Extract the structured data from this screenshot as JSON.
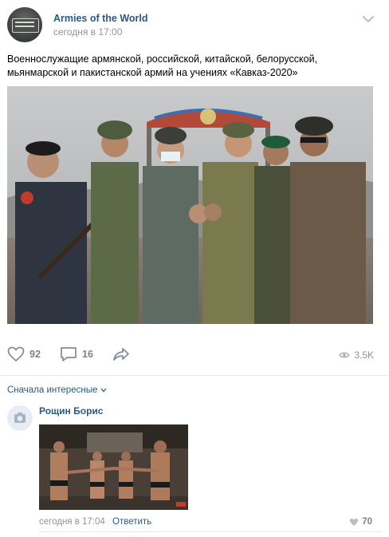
{
  "post": {
    "group_name": "Armies of the World",
    "time": "сегодня в 17:00",
    "text": "Военнослужащие армянской, российской, китайской, белорусской, мьянмарской и пакистанской армий на учениях «Кавказ-2020»",
    "likes": "92",
    "comments": "16",
    "views": "3.5K"
  },
  "icons": {
    "group_avatar": "armies-of-the-world-avatar",
    "menu": "chevron-down-icon",
    "like": "heart-icon",
    "comment": "comment-icon",
    "share": "share-arrow-icon",
    "views": "eye-icon",
    "camera": "camera-icon"
  },
  "comments_section": {
    "sort_label": "Сначала интересные",
    "items": [
      {
        "author": "Рощин Борис",
        "time": "сегодня в 17:04",
        "reply_label": "Ответить",
        "likes": "70"
      }
    ]
  },
  "colors": {
    "link": "#2a5885",
    "muted": "#939393",
    "divider": "#e7e8ec"
  }
}
